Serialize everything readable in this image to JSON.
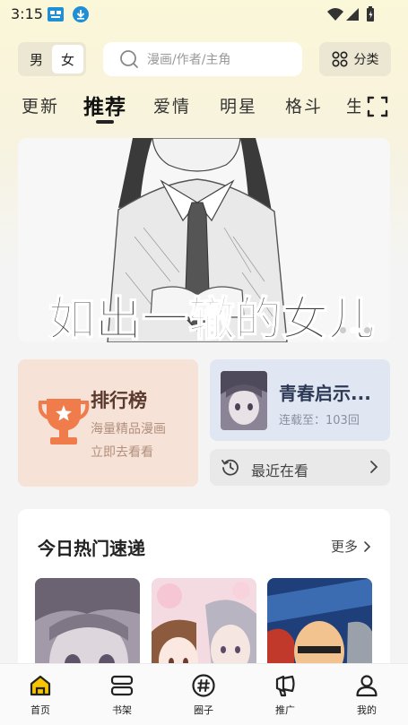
{
  "status_bar": {
    "time": "3:15",
    "icons": [
      "app-notification-icon",
      "download-icon",
      "wifi-icon",
      "signal-icon",
      "battery-icon"
    ]
  },
  "header": {
    "gender": {
      "male": "男",
      "female": "女",
      "selected": "女"
    },
    "search": {
      "placeholder": "漫画/作者/主角"
    },
    "category_label": "分类"
  },
  "tabs": [
    {
      "label": "更新",
      "active": false
    },
    {
      "label": "推荐",
      "active": true
    },
    {
      "label": "爱情",
      "active": false
    },
    {
      "label": "明星",
      "active": false
    },
    {
      "label": "格斗",
      "active": false
    },
    {
      "label": "生活",
      "active": false
    }
  ],
  "banner": {
    "caption": "如出一辙的女儿"
  },
  "ranking": {
    "title": "排行榜",
    "line1": "海量精品漫画",
    "line2": "立即去看看"
  },
  "continue_reading": {
    "title": "青春启示...",
    "progress": "连载至：103回"
  },
  "recent": {
    "label": "最近在看"
  },
  "hot": {
    "title": "今日热门速递",
    "more": "更多"
  },
  "bottom_nav": [
    {
      "label": "首页",
      "icon": "home-icon",
      "active": true
    },
    {
      "label": "书架",
      "icon": "bookshelf-icon",
      "active": false
    },
    {
      "label": "圈子",
      "icon": "circle-icon",
      "active": false
    },
    {
      "label": "推广",
      "icon": "promote-icon",
      "active": false
    },
    {
      "label": "我的",
      "icon": "profile-icon",
      "active": false
    }
  ],
  "colors": {
    "accent_yellow": "#f6c400",
    "ranking_bg": "#f7e2d7",
    "trophy": "#f07b4b",
    "continue_bg": "#e1e7f2"
  }
}
